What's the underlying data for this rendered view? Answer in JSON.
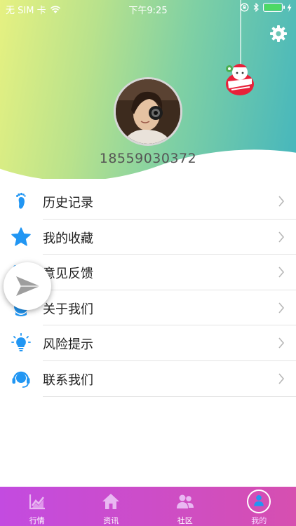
{
  "status_bar": {
    "carrier": "无 SIM 卡",
    "time": "下午9:25",
    "battery_color": "#4cd964"
  },
  "profile": {
    "phone": "18559030372"
  },
  "menu": {
    "items": [
      {
        "label": "历史记录",
        "icon": "footprint-icon"
      },
      {
        "label": "我的收藏",
        "icon": "star-icon"
      },
      {
        "label": "意见反馈",
        "icon": "feedback-icon"
      },
      {
        "label": "关于我们",
        "icon": "about-icon"
      },
      {
        "label": "风险提示",
        "icon": "lightbulb-icon"
      },
      {
        "label": "联系我们",
        "icon": "headset-icon"
      }
    ]
  },
  "tabbar": {
    "tabs": [
      {
        "label": "行情",
        "icon": "chart-icon"
      },
      {
        "label": "资讯",
        "icon": "home-icon"
      },
      {
        "label": "社区",
        "icon": "community-icon"
      },
      {
        "label": "我的",
        "icon": "user-icon",
        "active": true
      }
    ]
  },
  "colors": {
    "accent_blue": "#2196f3",
    "tabbar_start": "#c34be0",
    "tabbar_end": "#d64fb0"
  }
}
